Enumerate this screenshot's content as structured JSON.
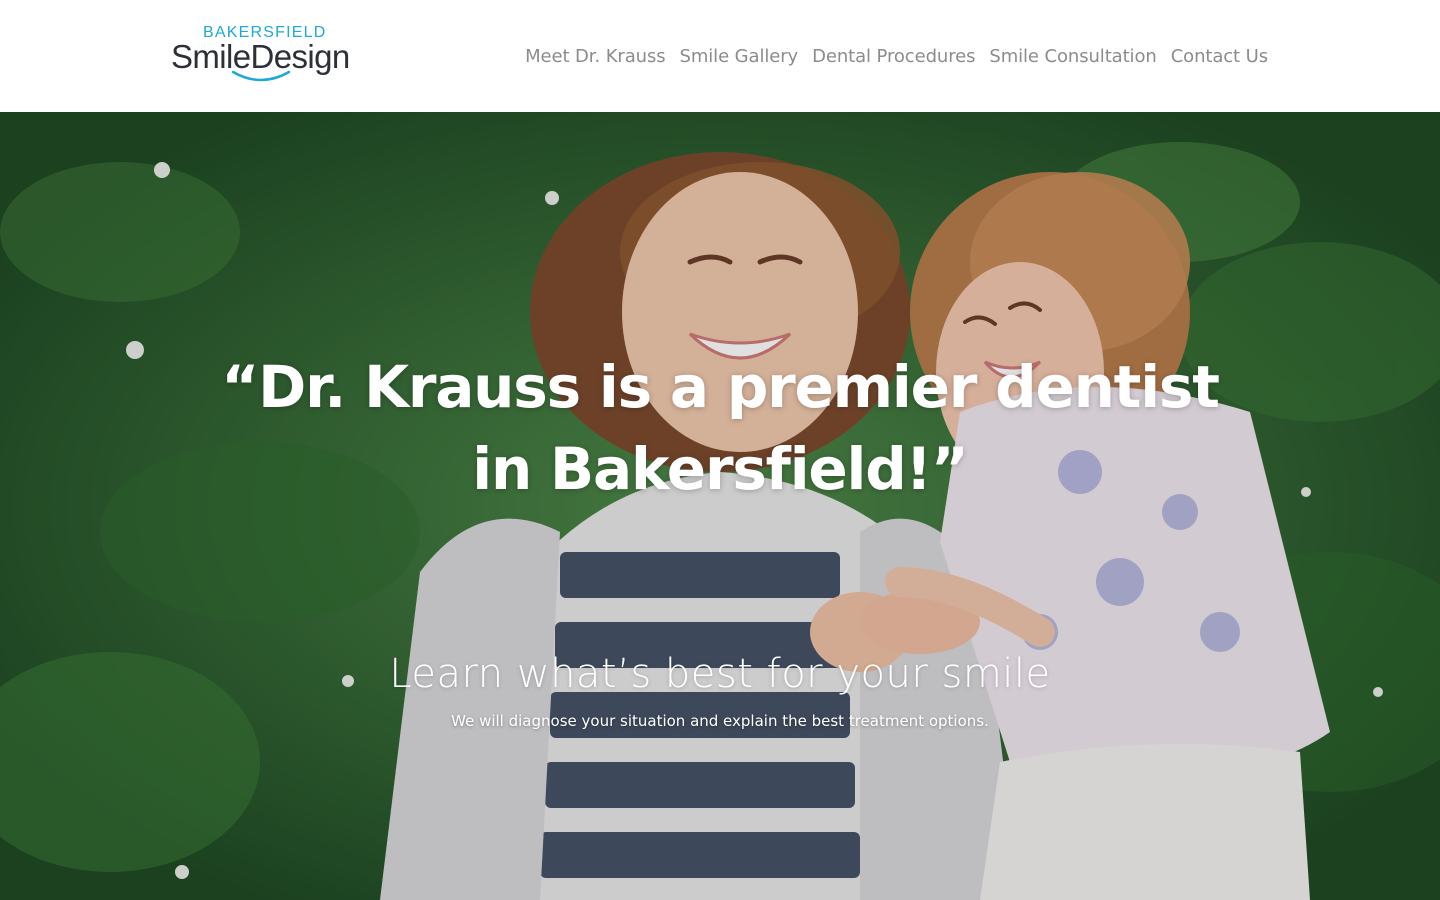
{
  "brand": {
    "logo_top": "BAKERSFIELD",
    "logo_main": "SmileDesign",
    "accent_color": "#1fa8d8",
    "dark_color": "#2d3137"
  },
  "nav": {
    "items": [
      {
        "label": "Meet Dr. Krauss"
      },
      {
        "label": "Smile Gallery"
      },
      {
        "label": "Dental Procedures"
      },
      {
        "label": "Smile Consultation"
      },
      {
        "label": "Contact Us"
      }
    ]
  },
  "hero": {
    "headline": "“Dr. Krauss is a premier dentist in Bakersfield!”",
    "subheadline": "Learn what’s best for your smile",
    "description": "We will diagnose your situation and explain the best treatment options.",
    "image_subject": "mother-and-daughter-laughing-in-grass"
  }
}
